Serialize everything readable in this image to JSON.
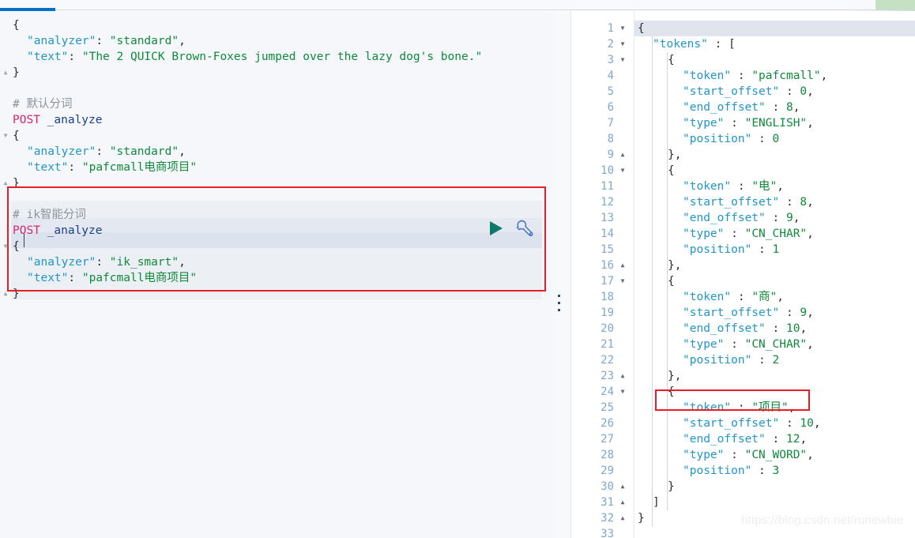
{
  "topbar": {
    "tab_indicator_color": "#0071c2",
    "chip_color": "#c6e0c4"
  },
  "colors": {
    "key": "#2196c9",
    "string": "#0f8a3c",
    "method": "#d6246e",
    "comment": "#8c949e",
    "url": "#1b3f8b",
    "line_number": "#7ea8cf",
    "annotation_red": "#ec1c24",
    "play_green": "#0c7a6b",
    "wrench_blue": "#3f6fc4"
  },
  "left_editor": {
    "name": "console-request-editor",
    "fold_markers": [
      "up",
      "down",
      "up",
      "down",
      "up"
    ],
    "lines": [
      {
        "indent": 0,
        "tokens": [
          {
            "t": "{",
            "c": "brace"
          }
        ]
      },
      {
        "indent": 1,
        "tokens": [
          {
            "t": "\"analyzer\"",
            "c": "key"
          },
          {
            "t": ": ",
            "c": "punct"
          },
          {
            "t": "\"standard\"",
            "c": "str"
          },
          {
            "t": ",",
            "c": "punct"
          }
        ]
      },
      {
        "indent": 1,
        "tokens": [
          {
            "t": "\"text\"",
            "c": "key"
          },
          {
            "t": ": ",
            "c": "punct"
          },
          {
            "t": "\"The 2 QUICK Brown-Foxes jumped over the lazy dog's bone.\"",
            "c": "str"
          }
        ]
      },
      {
        "indent": 0,
        "tokens": [
          {
            "t": "}",
            "c": "brace"
          }
        ]
      },
      {
        "indent": 0,
        "tokens": []
      },
      {
        "indent": 0,
        "tokens": [
          {
            "t": "# 默认分词",
            "c": "comment"
          }
        ]
      },
      {
        "indent": 0,
        "tokens": [
          {
            "t": "POST",
            "c": "method"
          },
          {
            "t": " ",
            "c": "punct"
          },
          {
            "t": "_analyze",
            "c": "url"
          }
        ]
      },
      {
        "indent": 0,
        "tokens": [
          {
            "t": "{",
            "c": "brace"
          }
        ]
      },
      {
        "indent": 1,
        "tokens": [
          {
            "t": "\"analyzer\"",
            "c": "key"
          },
          {
            "t": ": ",
            "c": "punct"
          },
          {
            "t": "\"standard\"",
            "c": "str"
          },
          {
            "t": ",",
            "c": "punct"
          }
        ]
      },
      {
        "indent": 1,
        "tokens": [
          {
            "t": "\"text\"",
            "c": "key"
          },
          {
            "t": ": ",
            "c": "punct"
          },
          {
            "t": "\"pafcmall电商项目\"",
            "c": "str"
          }
        ]
      },
      {
        "indent": 0,
        "tokens": [
          {
            "t": "}",
            "c": "brace"
          }
        ]
      },
      {
        "indent": 0,
        "tokens": []
      },
      {
        "indent": 0,
        "tokens": [
          {
            "t": "# ik智能分词",
            "c": "comment"
          }
        ]
      },
      {
        "indent": 0,
        "tokens": [
          {
            "t": "POST",
            "c": "method"
          },
          {
            "t": " ",
            "c": "punct"
          },
          {
            "t": "_analyze",
            "c": "url"
          }
        ]
      },
      {
        "indent": 0,
        "tokens": [
          {
            "t": "{",
            "c": "brace"
          }
        ]
      },
      {
        "indent": 1,
        "tokens": [
          {
            "t": "\"analyzer\"",
            "c": "key"
          },
          {
            "t": ": ",
            "c": "punct"
          },
          {
            "t": "\"ik_smart\"",
            "c": "str"
          },
          {
            "t": ",",
            "c": "punct"
          }
        ]
      },
      {
        "indent": 1,
        "tokens": [
          {
            "t": "\"text\"",
            "c": "key"
          },
          {
            "t": ": ",
            "c": "punct"
          },
          {
            "t": "\"pafcmall电商项目\"",
            "c": "str"
          }
        ]
      },
      {
        "indent": 0,
        "tokens": [
          {
            "t": "}",
            "c": "brace"
          }
        ]
      }
    ]
  },
  "right_editor": {
    "name": "console-response-viewer",
    "lines": [
      {
        "n": "1",
        "fold": "down",
        "indent": 0,
        "tokens": [
          {
            "t": "{",
            "c": "brace"
          }
        ]
      },
      {
        "n": "2",
        "fold": "down",
        "indent": 1,
        "tokens": [
          {
            "t": "\"tokens\"",
            "c": "key"
          },
          {
            "t": " : ",
            "c": "punct"
          },
          {
            "t": "[",
            "c": "brace"
          }
        ]
      },
      {
        "n": "3",
        "fold": "down",
        "indent": 2,
        "tokens": [
          {
            "t": "{",
            "c": "brace"
          }
        ]
      },
      {
        "n": "4",
        "fold": "",
        "indent": 3,
        "tokens": [
          {
            "t": "\"token\"",
            "c": "key"
          },
          {
            "t": " : ",
            "c": "punct"
          },
          {
            "t": "\"pafcmall\"",
            "c": "str"
          },
          {
            "t": ",",
            "c": "punct"
          }
        ]
      },
      {
        "n": "5",
        "fold": "",
        "indent": 3,
        "tokens": [
          {
            "t": "\"start_offset\"",
            "c": "key"
          },
          {
            "t": " : ",
            "c": "punct"
          },
          {
            "t": "0",
            "c": "num"
          },
          {
            "t": ",",
            "c": "punct"
          }
        ]
      },
      {
        "n": "6",
        "fold": "",
        "indent": 3,
        "tokens": [
          {
            "t": "\"end_offset\"",
            "c": "key"
          },
          {
            "t": " : ",
            "c": "punct"
          },
          {
            "t": "8",
            "c": "num"
          },
          {
            "t": ",",
            "c": "punct"
          }
        ]
      },
      {
        "n": "7",
        "fold": "",
        "indent": 3,
        "tokens": [
          {
            "t": "\"type\"",
            "c": "key"
          },
          {
            "t": " : ",
            "c": "punct"
          },
          {
            "t": "\"ENGLISH\"",
            "c": "str"
          },
          {
            "t": ",",
            "c": "punct"
          }
        ]
      },
      {
        "n": "8",
        "fold": "",
        "indent": 3,
        "tokens": [
          {
            "t": "\"position\"",
            "c": "key"
          },
          {
            "t": " : ",
            "c": "punct"
          },
          {
            "t": "0",
            "c": "num"
          }
        ]
      },
      {
        "n": "9",
        "fold": "up",
        "indent": 2,
        "tokens": [
          {
            "t": "},",
            "c": "brace"
          }
        ]
      },
      {
        "n": "10",
        "fold": "down",
        "indent": 2,
        "tokens": [
          {
            "t": "{",
            "c": "brace"
          }
        ]
      },
      {
        "n": "11",
        "fold": "",
        "indent": 3,
        "tokens": [
          {
            "t": "\"token\"",
            "c": "key"
          },
          {
            "t": " : ",
            "c": "punct"
          },
          {
            "t": "\"电\"",
            "c": "str"
          },
          {
            "t": ",",
            "c": "punct"
          }
        ]
      },
      {
        "n": "12",
        "fold": "",
        "indent": 3,
        "tokens": [
          {
            "t": "\"start_offset\"",
            "c": "key"
          },
          {
            "t": " : ",
            "c": "punct"
          },
          {
            "t": "8",
            "c": "num"
          },
          {
            "t": ",",
            "c": "punct"
          }
        ]
      },
      {
        "n": "13",
        "fold": "",
        "indent": 3,
        "tokens": [
          {
            "t": "\"end_offset\"",
            "c": "key"
          },
          {
            "t": " : ",
            "c": "punct"
          },
          {
            "t": "9",
            "c": "num"
          },
          {
            "t": ",",
            "c": "punct"
          }
        ]
      },
      {
        "n": "14",
        "fold": "",
        "indent": 3,
        "tokens": [
          {
            "t": "\"type\"",
            "c": "key"
          },
          {
            "t": " : ",
            "c": "punct"
          },
          {
            "t": "\"CN_CHAR\"",
            "c": "str"
          },
          {
            "t": ",",
            "c": "punct"
          }
        ]
      },
      {
        "n": "15",
        "fold": "",
        "indent": 3,
        "tokens": [
          {
            "t": "\"position\"",
            "c": "key"
          },
          {
            "t": " : ",
            "c": "punct"
          },
          {
            "t": "1",
            "c": "num"
          }
        ]
      },
      {
        "n": "16",
        "fold": "up",
        "indent": 2,
        "tokens": [
          {
            "t": "},",
            "c": "brace"
          }
        ]
      },
      {
        "n": "17",
        "fold": "down",
        "indent": 2,
        "tokens": [
          {
            "t": "{",
            "c": "brace"
          }
        ]
      },
      {
        "n": "18",
        "fold": "",
        "indent": 3,
        "tokens": [
          {
            "t": "\"token\"",
            "c": "key"
          },
          {
            "t": " : ",
            "c": "punct"
          },
          {
            "t": "\"商\"",
            "c": "str"
          },
          {
            "t": ",",
            "c": "punct"
          }
        ]
      },
      {
        "n": "19",
        "fold": "",
        "indent": 3,
        "tokens": [
          {
            "t": "\"start_offset\"",
            "c": "key"
          },
          {
            "t": " : ",
            "c": "punct"
          },
          {
            "t": "9",
            "c": "num"
          },
          {
            "t": ",",
            "c": "punct"
          }
        ]
      },
      {
        "n": "20",
        "fold": "",
        "indent": 3,
        "tokens": [
          {
            "t": "\"end_offset\"",
            "c": "key"
          },
          {
            "t": " : ",
            "c": "punct"
          },
          {
            "t": "10",
            "c": "num"
          },
          {
            "t": ",",
            "c": "punct"
          }
        ]
      },
      {
        "n": "21",
        "fold": "",
        "indent": 3,
        "tokens": [
          {
            "t": "\"type\"",
            "c": "key"
          },
          {
            "t": " : ",
            "c": "punct"
          },
          {
            "t": "\"CN_CHAR\"",
            "c": "str"
          },
          {
            "t": ",",
            "c": "punct"
          }
        ]
      },
      {
        "n": "22",
        "fold": "",
        "indent": 3,
        "tokens": [
          {
            "t": "\"position\"",
            "c": "key"
          },
          {
            "t": " : ",
            "c": "punct"
          },
          {
            "t": "2",
            "c": "num"
          }
        ]
      },
      {
        "n": "23",
        "fold": "up",
        "indent": 2,
        "tokens": [
          {
            "t": "},",
            "c": "brace"
          }
        ]
      },
      {
        "n": "24",
        "fold": "down",
        "indent": 2,
        "tokens": [
          {
            "t": "{",
            "c": "brace"
          }
        ]
      },
      {
        "n": "25",
        "fold": "",
        "indent": 3,
        "tokens": [
          {
            "t": "\"token\"",
            "c": "key"
          },
          {
            "t": " : ",
            "c": "punct"
          },
          {
            "t": "\"项目\"",
            "c": "str"
          },
          {
            "t": ",",
            "c": "punct"
          }
        ]
      },
      {
        "n": "26",
        "fold": "",
        "indent": 3,
        "tokens": [
          {
            "t": "\"start_offset\"",
            "c": "key"
          },
          {
            "t": " : ",
            "c": "punct"
          },
          {
            "t": "10",
            "c": "num"
          },
          {
            "t": ",",
            "c": "punct"
          }
        ]
      },
      {
        "n": "27",
        "fold": "",
        "indent": 3,
        "tokens": [
          {
            "t": "\"end_offset\"",
            "c": "key"
          },
          {
            "t": " : ",
            "c": "punct"
          },
          {
            "t": "12",
            "c": "num"
          },
          {
            "t": ",",
            "c": "punct"
          }
        ]
      },
      {
        "n": "28",
        "fold": "",
        "indent": 3,
        "tokens": [
          {
            "t": "\"type\"",
            "c": "key"
          },
          {
            "t": " : ",
            "c": "punct"
          },
          {
            "t": "\"CN_WORD\"",
            "c": "str"
          },
          {
            "t": ",",
            "c": "punct"
          }
        ]
      },
      {
        "n": "29",
        "fold": "",
        "indent": 3,
        "tokens": [
          {
            "t": "\"position\"",
            "c": "key"
          },
          {
            "t": " : ",
            "c": "punct"
          },
          {
            "t": "3",
            "c": "num"
          }
        ]
      },
      {
        "n": "30",
        "fold": "up",
        "indent": 2,
        "tokens": [
          {
            "t": "}",
            "c": "brace"
          }
        ]
      },
      {
        "n": "31",
        "fold": "up",
        "indent": 1,
        "tokens": [
          {
            "t": "]",
            "c": "brace"
          }
        ]
      },
      {
        "n": "32",
        "fold": "up",
        "indent": 0,
        "tokens": [
          {
            "t": "}",
            "c": "brace"
          }
        ]
      },
      {
        "n": "33",
        "fold": "",
        "indent": 0,
        "tokens": []
      }
    ]
  },
  "actions": {
    "play_label": "send-request",
    "wrench_label": "request-options"
  },
  "watermark": {
    "text": "https://blog.csdn.net/runewbie"
  }
}
